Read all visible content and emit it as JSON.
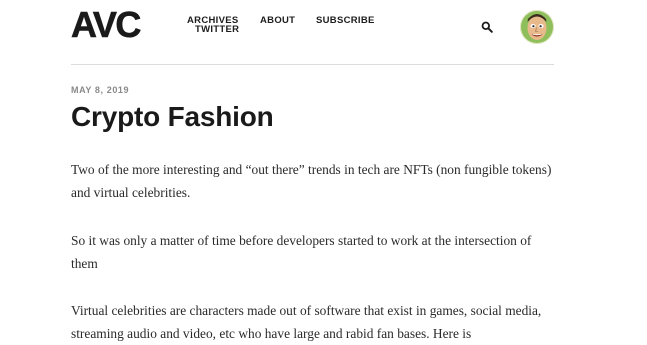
{
  "header": {
    "logo": "AVC",
    "nav": {
      "archives": "ARCHIVES",
      "twitter": "TWITTER",
      "about": "ABOUT",
      "subscribe": "SUBSCRIBE"
    },
    "icons": {
      "search": "search-icon",
      "avatar": "avatar"
    }
  },
  "post": {
    "date": "MAY 8, 2019",
    "title": "Crypto Fashion",
    "paragraphs": [
      "Two of the more interesting and “out there” trends in tech are NFTs (non fungible tokens) and virtual celebrities.",
      "So it was only a matter of time before developers started to work at the intersection of them",
      "Virtual celebrities are characters made out of software that exist in games, social media, streaming audio and video, etc who have large and rabid fan bases. Here is"
    ]
  },
  "colors": {
    "text": "#1a1a1a",
    "muted": "#8a8a8a",
    "divider": "#dcdcdc"
  }
}
